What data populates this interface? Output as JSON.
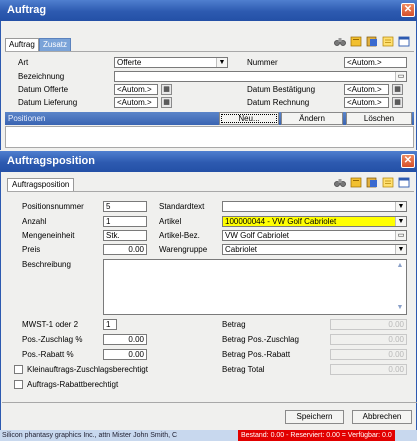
{
  "auftrag_window": {
    "title": "Auftrag",
    "tabs": [
      {
        "label": "Auftrag"
      },
      {
        "label": "Zusatz"
      }
    ],
    "fields": {
      "art": {
        "label": "Art",
        "value": "Offerte"
      },
      "nummer": {
        "label": "Nummer",
        "value": "<Autom.>"
      },
      "bezeichnung": {
        "label": "Bezeichnung",
        "value": ""
      },
      "datum_offerte": {
        "label": "Datum Offerte",
        "value": "<Autom.>"
      },
      "datum_bestaetigung": {
        "label": "Datum Bestätigung",
        "value": "<Autom.>"
      },
      "datum_lieferung": {
        "label": "Datum Lieferung",
        "value": "<Autom.>"
      },
      "datum_rechnung": {
        "label": "Datum Rechnung",
        "value": "<Autom.>"
      }
    },
    "positionen_label": "Positionen",
    "buttons": {
      "neu": "Neu...",
      "aendern": "Ändern",
      "loeschen": "Löschen"
    }
  },
  "position_window": {
    "title": "Auftragsposition",
    "tab": "Auftragsposition",
    "fields": {
      "positionsnummer": {
        "label": "Positionsnummer",
        "value": "5"
      },
      "anzahl": {
        "label": "Anzahl",
        "value": "1"
      },
      "mengeneinheit": {
        "label": "Mengeneinheit",
        "value": "Stk."
      },
      "preis": {
        "label": "Preis",
        "value": "0.00"
      },
      "standardtext": {
        "label": "Standardtext",
        "value": ""
      },
      "artikel": {
        "label": "Artikel",
        "value": "100000044 - VW Golf Cabriolet"
      },
      "artikel_bez": {
        "label": "Artikel-Bez.",
        "value": "VW Golf Cabriolet"
      },
      "warengruppe": {
        "label": "Warengruppe",
        "value": "Cabriolet"
      },
      "beschreibung": {
        "label": "Beschreibung",
        "value": ""
      },
      "mwst": {
        "label": "MWST-1 oder 2",
        "value": "1"
      },
      "pos_zuschlag": {
        "label": "Pos.-Zuschlag %",
        "value": "0.00"
      },
      "pos_rabatt": {
        "label": "Pos.-Rabatt %",
        "value": "0.00"
      },
      "betrag": {
        "label": "Betrag",
        "value": "0.00"
      },
      "betrag_pos_zuschlag": {
        "label": "Betrag Pos.-Zuschlag",
        "value": "0.00"
      },
      "betrag_pos_rabatt": {
        "label": "Betrag Pos.-Rabatt",
        "value": "0.00"
      },
      "betrag_total": {
        "label": "Betrag Total",
        "value": "0.00"
      }
    },
    "checkboxes": {
      "klein_zuschlag": {
        "label": "Kleinauftrags-Zuschlagsberechtigt",
        "checked": false
      },
      "rabatt": {
        "label": "Auftrags-Rabattberechtigt",
        "checked": false
      }
    },
    "buttons": {
      "speichern": "Speichern",
      "abbrechen": "Abbrechen"
    }
  },
  "statusbar": {
    "text": "Silicon phantasy graphics Inc., attn Mister John Smith, C",
    "warning": "Bestand: 0.00 - Reserviert: 0.00 = Verfügbar: 0.0"
  },
  "colors": {
    "titlebar": "#2d5ab0",
    "highlight_field": "#ffff00",
    "warning_bg": "#e20000"
  },
  "icons": [
    "binoculars-icon",
    "book-icon",
    "paste-icon",
    "note-icon",
    "window-icon",
    "calendar-icon",
    "dropdown-arrow-icon",
    "close-icon"
  ]
}
